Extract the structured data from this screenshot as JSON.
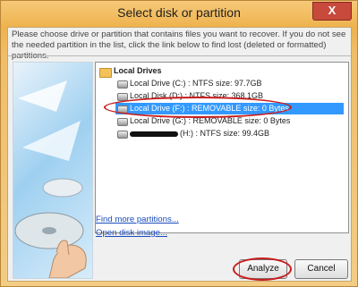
{
  "window": {
    "title": "Select disk or partition",
    "close_label": "X"
  },
  "instructions": "Please choose drive or partition that contains files you want to recover. If you do not see the needed partition in the list, click the link below to find lost (deleted or formatted) partitions.",
  "tree": {
    "root_label": "Local Drives",
    "items": [
      {
        "label": "Local Drive (C:) : NTFS size: 97.7GB",
        "selected": false
      },
      {
        "label": "Local Disk (D:) : NTFS size: 368.1GB",
        "selected": false
      },
      {
        "label": "Local Drive (F:) : REMOVABLE size: 0 Bytes",
        "selected": true
      },
      {
        "label": "Local Drive (G:) : REMOVABLE size: 0 Bytes",
        "selected": false
      },
      {
        "label": "(H:) : NTFS size: 99.4GB",
        "selected": false,
        "name_obscured": true
      }
    ]
  },
  "links": {
    "find_more": "Find more partitions...",
    "open_image": "Open disk image..."
  },
  "buttons": {
    "analyze": "Analyze",
    "cancel": "Cancel"
  },
  "colors": {
    "title_gradient": "#eeb24d",
    "selection": "#3399ff",
    "annotation": "#c81c1c"
  },
  "icons": {
    "root": "folder-icon",
    "drive": "hard-drive-icon",
    "close": "close-icon"
  }
}
